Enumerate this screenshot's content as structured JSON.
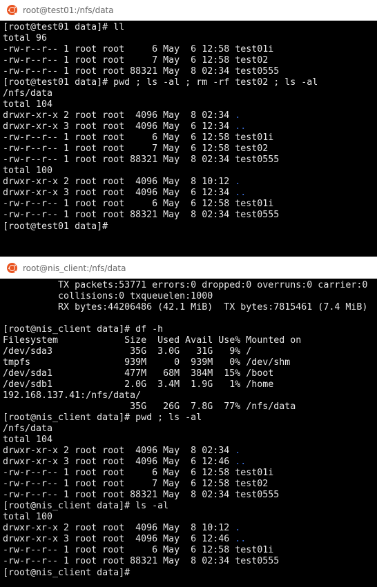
{
  "windows": [
    {
      "title": "root@test01:/nfs/data",
      "lines": [
        {
          "text": "[root@test01 data]# ll"
        },
        {
          "text": "total 96"
        },
        {
          "text": "-rw-r--r-- 1 root root     6 May  6 12:58 test01i"
        },
        {
          "text": "-rw-r--r-- 1 root root     7 May  6 12:58 test02"
        },
        {
          "text": "-rw-r--r-- 1 root root 88321 May  8 02:34 test0555"
        },
        {
          "text": "[root@test01 data]# pwd ; ls -al ; rm -rf test02 ; ls -al"
        },
        {
          "text": "/nfs/data"
        },
        {
          "text": "total 104"
        },
        {
          "text": "drwxr-xr-x 2 root root  4096 May  8 02:34 ",
          "dir": "."
        },
        {
          "text": "drwxr-xr-x 3 root root  4096 May  6 12:34 ",
          "dir": ".."
        },
        {
          "text": "-rw-r--r-- 1 root root     6 May  6 12:58 test01i"
        },
        {
          "text": "-rw-r--r-- 1 root root     7 May  6 12:58 test02"
        },
        {
          "text": "-rw-r--r-- 1 root root 88321 May  8 02:34 test0555"
        },
        {
          "text": "total 100"
        },
        {
          "text": "drwxr-xr-x 2 root root  4096 May  8 10:12 ",
          "dir": "."
        },
        {
          "text": "drwxr-xr-x 3 root root  4096 May  6 12:34 ",
          "dir": ".."
        },
        {
          "text": "-rw-r--r-- 1 root root     6 May  6 12:58 test01i"
        },
        {
          "text": "-rw-r--r-- 1 root root 88321 May  8 02:34 test0555"
        },
        {
          "text": "[root@test01 data]# "
        }
      ]
    },
    {
      "title": "root@nis_client:/nfs/data",
      "lines": [
        {
          "text": "          TX packets:53771 errors:0 dropped:0 overruns:0 carrier:0"
        },
        {
          "text": "          collisions:0 txqueuelen:1000"
        },
        {
          "text": "          RX bytes:44206486 (42.1 MiB)  TX bytes:7815461 (7.4 MiB)"
        },
        {
          "text": ""
        },
        {
          "text": "[root@nis_client data]# df -h"
        },
        {
          "text": "Filesystem            Size  Used Avail Use% Mounted on"
        },
        {
          "text": "/dev/sda3              35G  3.0G   31G   9% /"
        },
        {
          "text": "tmpfs                 939M     0  939M   0% /dev/shm"
        },
        {
          "text": "/dev/sda1             477M   68M  384M  15% /boot"
        },
        {
          "text": "/dev/sdb1             2.0G  3.4M  1.9G   1% /home"
        },
        {
          "text": "192.168.137.41:/nfs/data/"
        },
        {
          "text": "                       35G   26G  7.8G  77% /nfs/data"
        },
        {
          "text": "[root@nis_client data]# pwd ; ls -al"
        },
        {
          "text": "/nfs/data"
        },
        {
          "text": "total 104"
        },
        {
          "text": "drwxr-xr-x 2 root root  4096 May  8 02:34 ",
          "dir": "."
        },
        {
          "text": "drwxr-xr-x 3 root root  4096 May  6 12:46 ",
          "dir": ".."
        },
        {
          "text": "-rw-r--r-- 1 root root     6 May  6 12:58 test01i"
        },
        {
          "text": "-rw-r--r-- 1 root root     7 May  6 12:58 test02"
        },
        {
          "text": "-rw-r--r-- 1 root root 88321 May  8 02:34 test0555"
        },
        {
          "text": "[root@nis_client data]# ls -al"
        },
        {
          "text": "total 100"
        },
        {
          "text": "drwxr-xr-x 2 root root  4096 May  8 10:12 ",
          "dir": "."
        },
        {
          "text": "drwxr-xr-x 3 root root  4096 May  6 12:46 ",
          "dir": ".."
        },
        {
          "text": "-rw-r--r-- 1 root root     6 May  6 12:58 test01i"
        },
        {
          "text": "-rw-r--r-- 1 root root 88321 May  8 02:34 test0555"
        },
        {
          "text": "[root@nis_client data]# "
        }
      ]
    }
  ],
  "colors": {
    "terminal_bg": "#000000",
    "terminal_fg": "#e6e6e6",
    "directory": "#3b6fd8",
    "ubuntu_logo": "#e95420"
  },
  "icons": {
    "title_icon": "ubuntu-logo-icon"
  }
}
